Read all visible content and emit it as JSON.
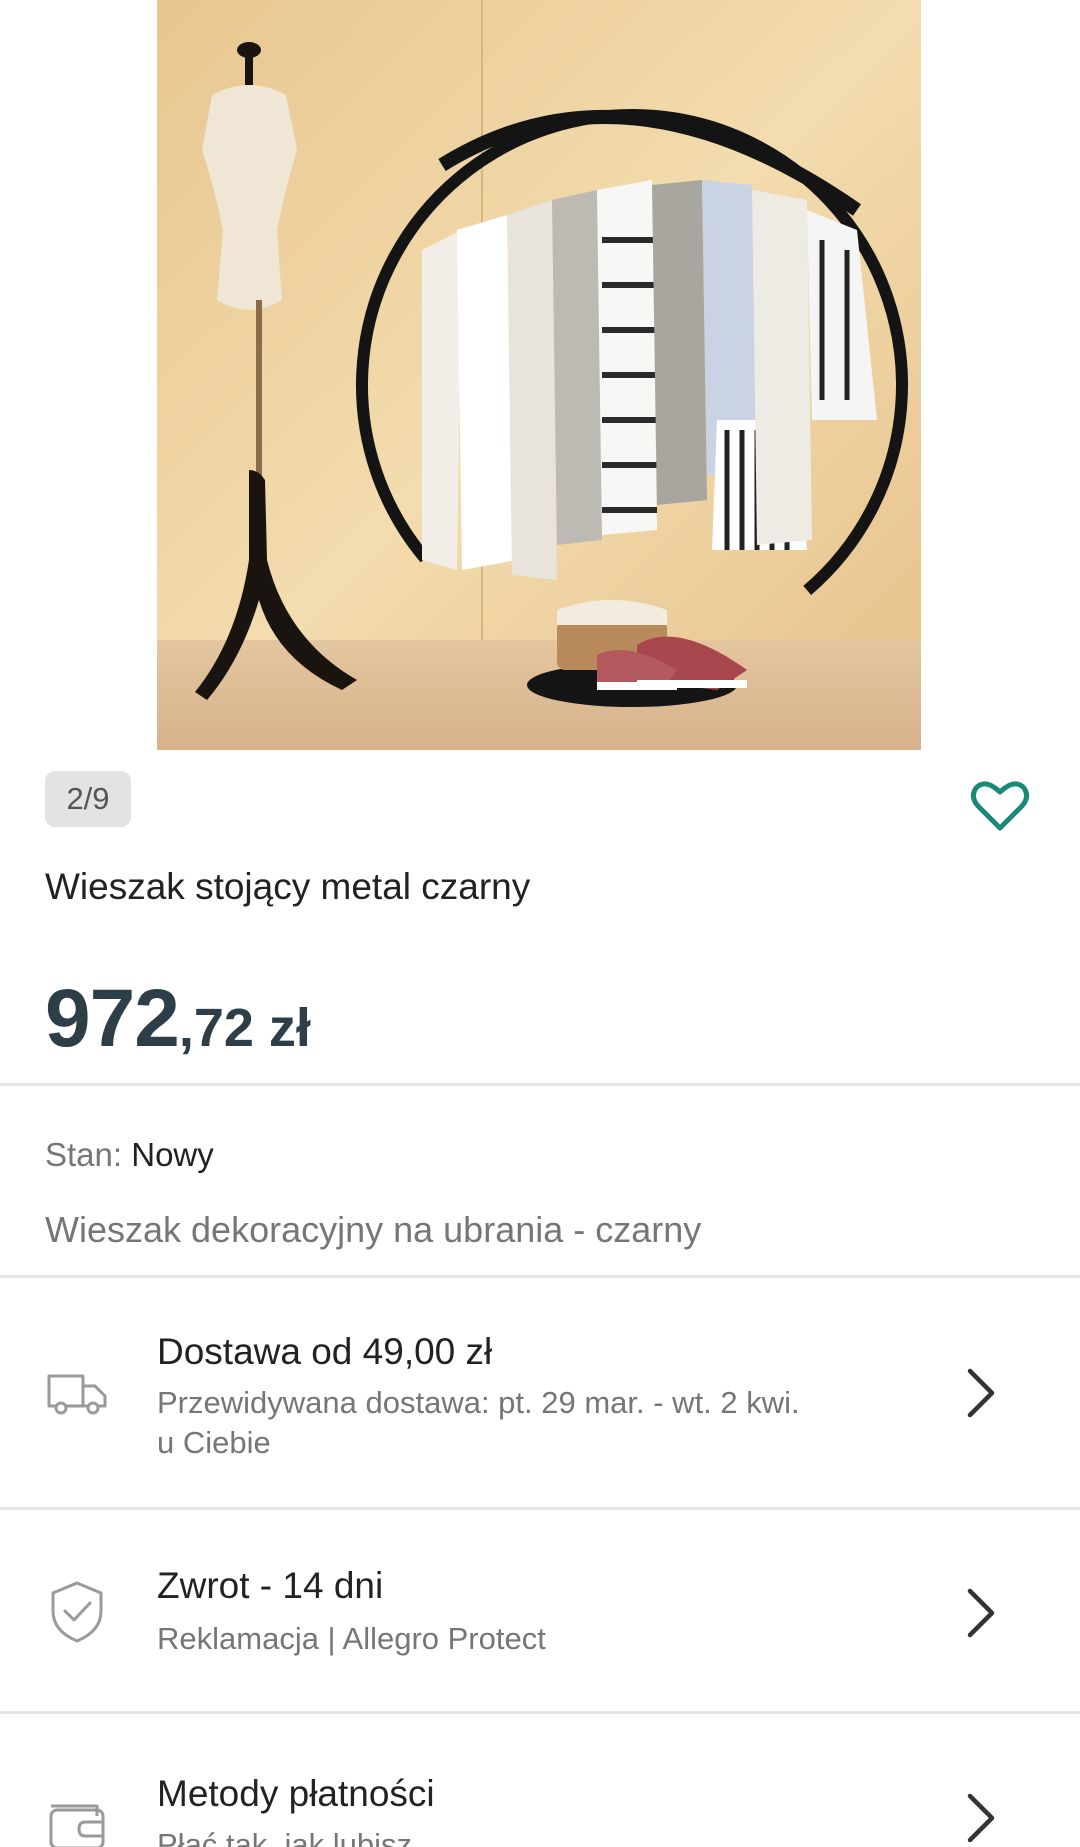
{
  "gallery": {
    "counter": "2/9",
    "image_alt": "black round standing clothes rack with mannequin"
  },
  "product": {
    "title": "Wieszak stojący metal czarny",
    "price_integer": "972",
    "price_decimal": ",72",
    "price_currency": " zł"
  },
  "condition": {
    "label": "Stan:",
    "value": "Nowy",
    "description": "Wieszak dekoracyjny na ubrania - czarny"
  },
  "rows": [
    {
      "icon": "delivery-truck-icon",
      "title": "Dostawa od 49,00 zł",
      "subtitle_line1": "Przewidywana dostawa: pt. 29 mar. - wt. 2 kwi.",
      "subtitle_line2": "u Ciebie"
    },
    {
      "icon": "shield-check-icon",
      "title": "Zwrot - 14 dni",
      "subtitle_line1": "Reklamacja | Allegro Protect"
    },
    {
      "icon": "wallet-icon",
      "title": "Metody płatności",
      "subtitle_line1": "Płać tak, jak lubisz"
    }
  ],
  "colors": {
    "accent": "#1a8a78",
    "price": "#2e3e48",
    "muted_text": "#767676",
    "divider": "#e5e5e5"
  }
}
